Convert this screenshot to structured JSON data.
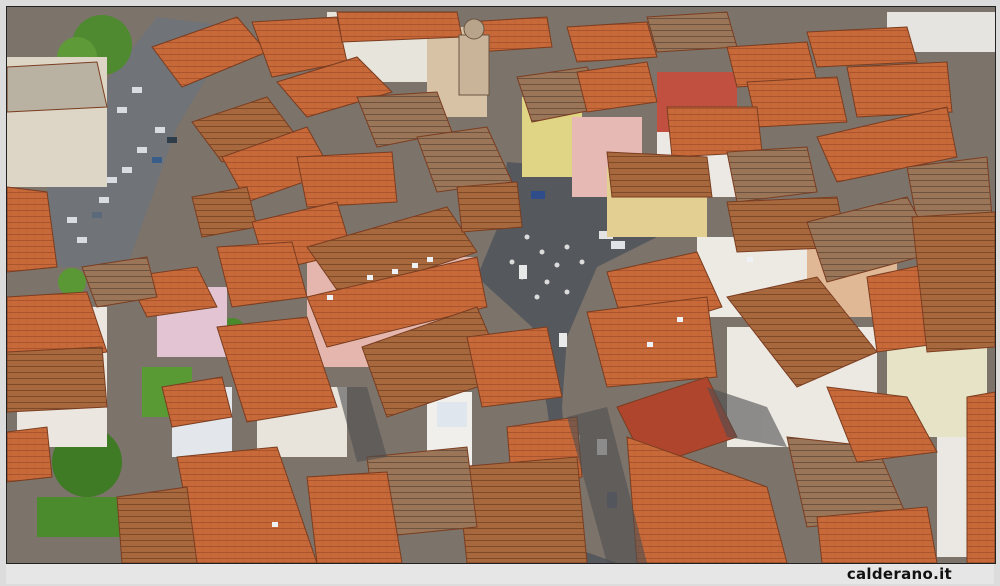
{
  "image": {
    "description_kind": "aerial photograph",
    "watermark": "calderano.it",
    "colors": {
      "roof_terracotta": "#c8693a",
      "roof_dark": "#8f4a2a",
      "wall_white": "#e9e3da",
      "wall_pink": "#e2b3a6",
      "wall_yellow": "#dcd08a",
      "pavement": "#55575a",
      "vegetation": "#4e8a2e",
      "parking": "#6f7276"
    }
  }
}
